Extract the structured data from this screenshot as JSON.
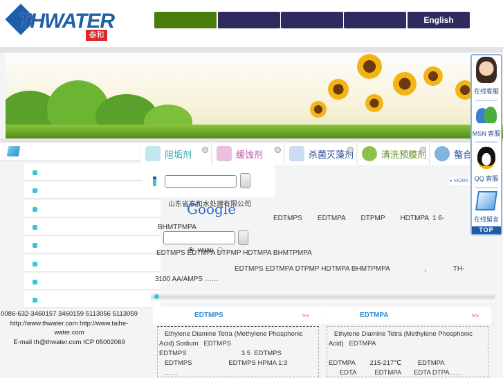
{
  "header": {
    "logo_text": "THWATER",
    "logo_seal": "泰和",
    "nav": [
      {
        "label": ""
      },
      {
        "label": ""
      },
      {
        "label": ""
      },
      {
        "label": ""
      },
      {
        "label": "English"
      }
    ],
    "accent": "#4a7d0e",
    "nav_color": "#2e2c5e"
  },
  "categories": [
    {
      "label": "阻垢剂",
      "color": "#3aa7b5"
    },
    {
      "label": "缓蚀剂",
      "color": "#c25bb0"
    },
    {
      "label": "杀菌灭藻剂",
      "color": "#2b4a9a"
    },
    {
      "label": "清洗预膜剂",
      "color": "#5a8c1f"
    },
    {
      "label": "螯合剂",
      "color": "#2b4a9a"
    }
  ],
  "search": {
    "company": "山东省泰和水处理有限公司",
    "google": "Google",
    "radio_www": "www"
  },
  "intro": {
    "line1": "EDTMPS        EDTMPA        DTPMP        HDTMPA  1 6-",
    "line2": "BHMTPMPA",
    "line3": "EDTMPS EDTMPA DTPMP HDTMPA BHMTPMPA",
    "line4": "EDTMPS EDTMPA DTPMP HDTMPA BHMTPMPA                  ,              TH-",
    "line5": "3100 AA/AMPS ……",
    "more": "MORE"
  },
  "footer": {
    "phone": "0086-632-3460157 3460159 5113056 5113059",
    "web": "http://www.thwater.com  http://www.taihe-water.com",
    "email": "E-mail  th@thwater.com  ICP 05002069"
  },
  "products": [
    {
      "title": "EDTMPS",
      "more": ">>",
      "lines": [
        "   Ethylene Diamine Tetra (Methylene Phosphonic Acid) Sodium   EDTMPS",
        "EDTMPS                              3 5  EDTMPS",
        "   EDTMPS                    EDTMPS HPMA 1:3",
        "   ……"
      ]
    },
    {
      "title": "EDTMPA",
      "more": ">>",
      "lines": [
        "   Ethylene Diamine Tetra (Methylene Phosphonic Acid)   EDTMPA",
        "",
        "EDTMPA        215-217℃         EDTMPA",
        "      EDTA          EDTMPA       EDTA DTPA……"
      ]
    }
  ],
  "float": {
    "items": [
      "在线客服",
      "MSN 客服",
      "QQ 客服",
      "在线留言"
    ],
    "top": "TOP"
  }
}
